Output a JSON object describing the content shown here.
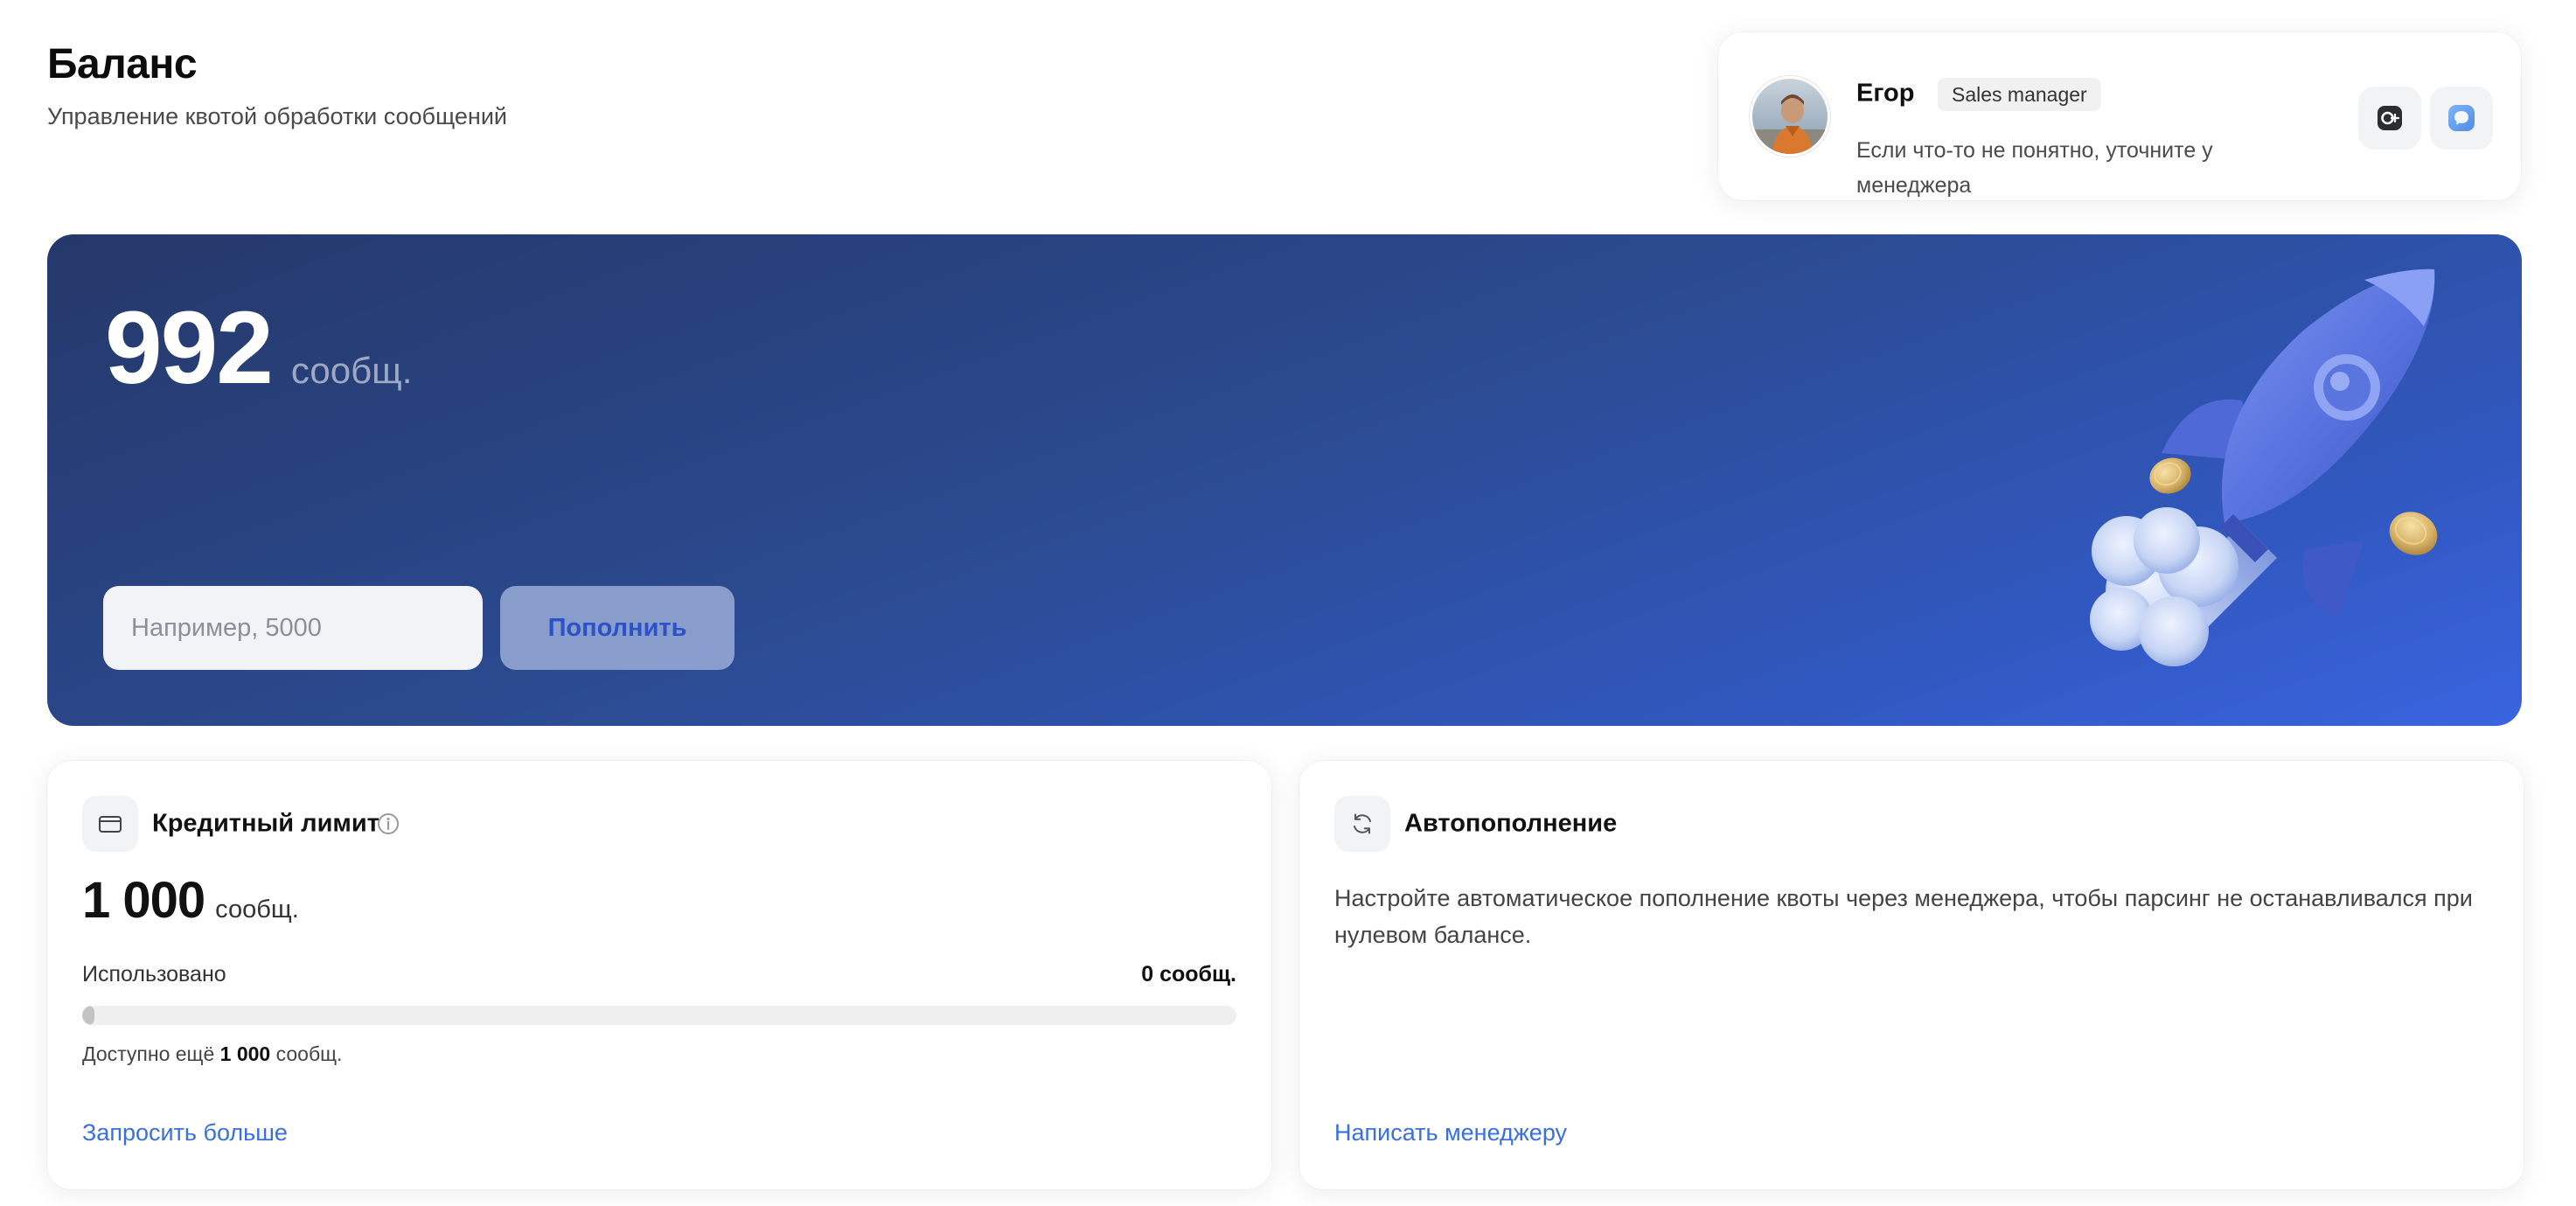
{
  "page": {
    "title": "Баланс",
    "subtitle": "Управление квотой обработки сообщений"
  },
  "manager": {
    "name": "Егор",
    "role": "Sales manager",
    "note": "Если что-то не понятно, уточните у менеджера",
    "avatar_icon": "manager-photo",
    "contacts": [
      {
        "icon": "max-messenger-icon"
      },
      {
        "icon": "chat-bubble-icon"
      }
    ]
  },
  "balance": {
    "value": "992",
    "unit": "сообщ.",
    "input_placeholder": "Например, 5000",
    "topup_label": "Пополнить",
    "illustration": "rocket-with-coins"
  },
  "credit": {
    "title": "Кредитный лимит",
    "value": "1 000",
    "unit": "сообщ.",
    "used_label": "Использовано",
    "used_value": "0 сообщ.",
    "used_fraction": 0,
    "available_prefix": "Доступно ещё",
    "available_value": "1 000",
    "available_suffix": "сообщ.",
    "link": "Запросить больше"
  },
  "autotopup": {
    "title": "Автопополнение",
    "description": "Настройте автоматическое пополнение квоты через менеджера, чтобы парсинг не останавливался при нулевом балансе.",
    "link": "Написать менеджеру"
  },
  "colors": {
    "accent": "#3a6fe0",
    "hero_start": "#25386a",
    "hero_end": "#3a64e0"
  }
}
